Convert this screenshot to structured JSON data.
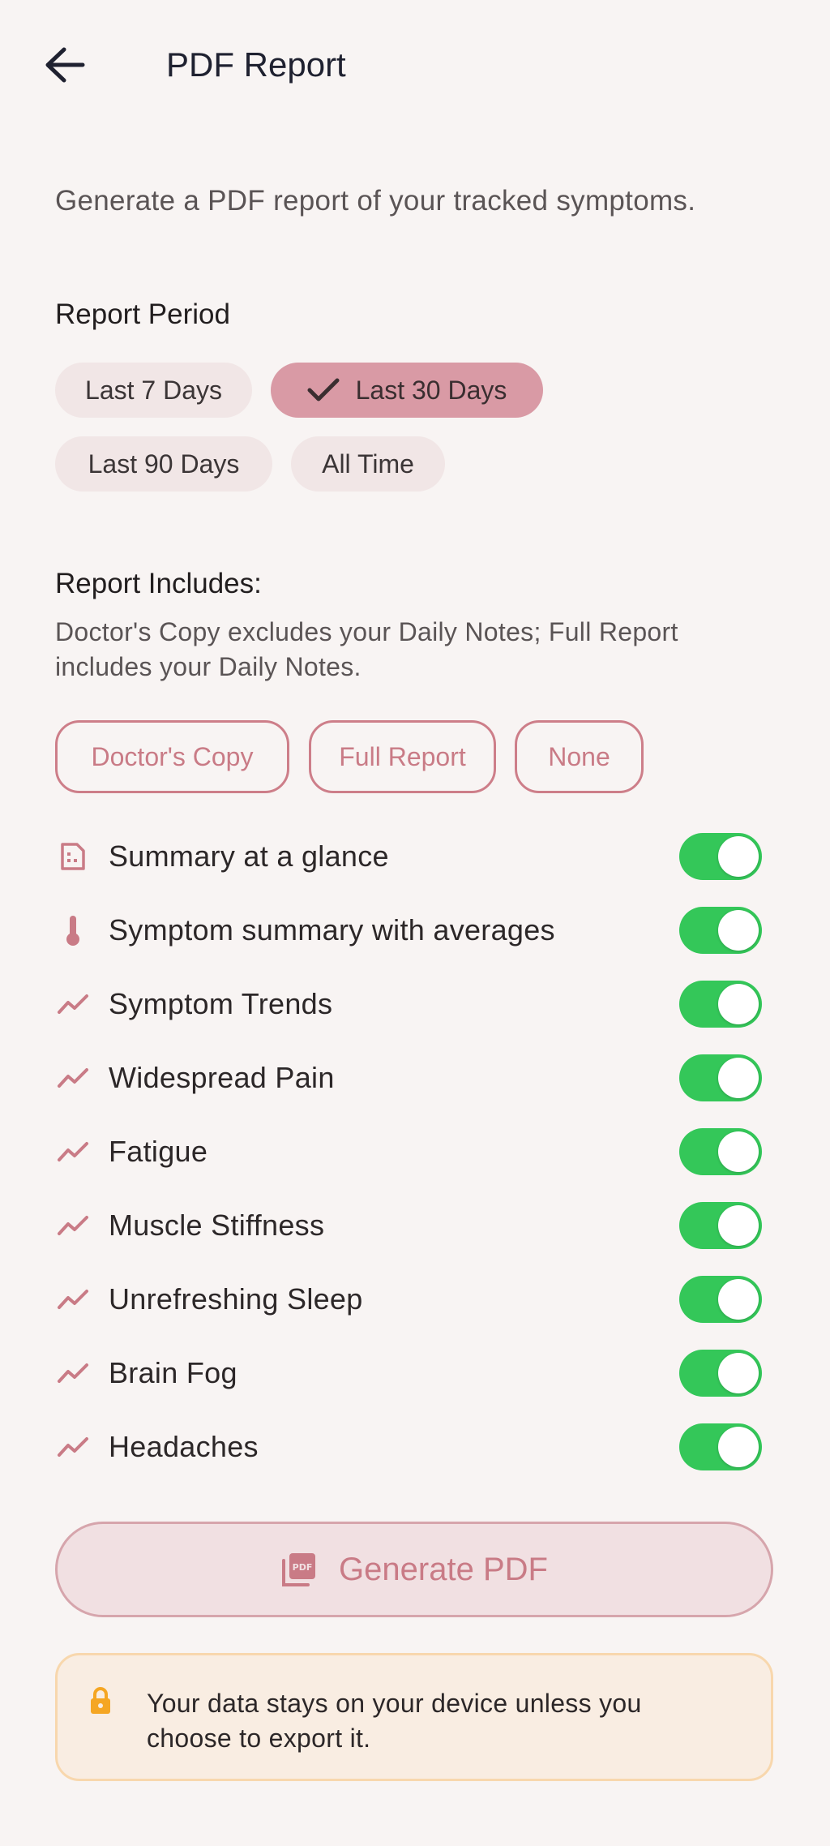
{
  "header": {
    "title": "PDF Report",
    "back_icon": "arrow-left-icon"
  },
  "intro": "Generate a PDF report of your tracked symptoms.",
  "report_period": {
    "title": "Report Period",
    "options": [
      "Last 7 Days",
      "Last 30 Days",
      "Last 90 Days",
      "All Time"
    ],
    "selected": "Last 30 Days"
  },
  "report_includes": {
    "title": "Report Includes:",
    "description": "Doctor's Copy excludes your Daily Notes; Full Report includes your Daily Notes.",
    "presets": [
      "Doctor's Copy",
      "Full Report",
      "None"
    ],
    "items": [
      {
        "label": "Summary at a glance",
        "icon": "summary-icon",
        "enabled": true
      },
      {
        "label": "Symptom summary with averages",
        "icon": "thermometer-icon",
        "enabled": true
      },
      {
        "label": "Symptom Trends",
        "icon": "trend-icon",
        "enabled": true
      },
      {
        "label": "Widespread Pain",
        "icon": "trend-icon",
        "enabled": true
      },
      {
        "label": "Fatigue",
        "icon": "trend-icon",
        "enabled": true
      },
      {
        "label": "Muscle Stiffness",
        "icon": "trend-icon",
        "enabled": true
      },
      {
        "label": "Unrefreshing Sleep",
        "icon": "trend-icon",
        "enabled": true
      },
      {
        "label": "Brain Fog",
        "icon": "trend-icon",
        "enabled": true
      },
      {
        "label": "Headaches",
        "icon": "trend-icon",
        "enabled": true
      }
    ]
  },
  "generate_button": {
    "label": "Generate PDF",
    "icon": "pdf-icon"
  },
  "privacy_note": {
    "text": "Your data stays on your device unless you choose to export it.",
    "icon": "lock-icon"
  },
  "colors": {
    "background": "#f8f4f3",
    "accent": "#c97b86",
    "selected_chip": "#d99aa5",
    "toggle_on": "#34c759",
    "notice_bg": "#f9ede2",
    "notice_icon": "#f5a623"
  }
}
